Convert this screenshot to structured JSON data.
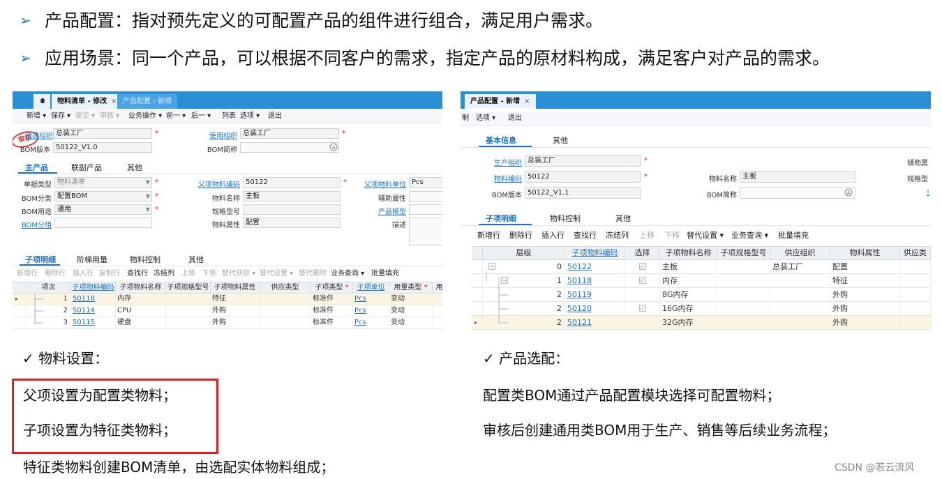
{
  "bullets": [
    {
      "text": "产品配置：指对预先定义的可配置产品的组件进行组合，满足用户需求。"
    },
    {
      "text": "应用场景：同一个产品，可以根据不同客户的需求，指定产品的原材料构成，满足客户对产品的需求。"
    }
  ],
  "icons": {
    "arrow": "➢",
    "check": "✓",
    "home": "home-icon",
    "close": "×"
  },
  "colors": {
    "accent": "#2b8fd6",
    "link": "#1f6fc4",
    "required": "#e02020",
    "highlight_box": "#e02020"
  },
  "left_panel": {
    "tabs": [
      {
        "label": "物料清单 - 修改",
        "close": "×"
      },
      {
        "label": "产品配置 - 新增"
      }
    ],
    "toolbar": [
      "新增 ▾",
      "保存 ▾",
      "提交 ▾",
      "审核 ▾",
      "业务操作 ▾",
      "前一 ▾",
      "后一 ▾",
      "列表",
      "选项 ▾",
      "退出"
    ],
    "stamp": "审核",
    "form_top": {
      "create_org_label": "创建组织",
      "create_org_value": "总装工厂",
      "bom_version_label": "BOM版本",
      "bom_version_value": "50122_V1.0",
      "use_org_label": "使用组织",
      "use_org_value": "总装工厂",
      "bom_short_label": "BOM简称",
      "bom_short_value": ""
    },
    "section_tabs": [
      "主产品",
      "联副产品",
      "其他"
    ],
    "form_main": {
      "doc_type_label": "单据类型",
      "doc_type_value": "物料清单",
      "bom_class_label": "BOM分类",
      "bom_class_value": "配置BOM",
      "bom_use_label": "BOM用途",
      "bom_use_value": "通用",
      "bom_group_label": "BOM分组",
      "bom_group_value": "",
      "parent_code_label": "父项物料编码",
      "parent_code_value": "50122",
      "material_name_label": "物料名称",
      "material_name_value": "主板",
      "spec_label": "规格型号",
      "spec_value": "",
      "material_attr_label": "物料属性",
      "material_attr_value": "配置",
      "parent_unit_label": "父项物料单位",
      "parent_unit_value": "Pcs",
      "aux_attr_label": "辅助属性",
      "product_model_label": "产品模型",
      "desc_label": "描述"
    },
    "detail_tabs": [
      "子项明细",
      "阶梯用量",
      "物料控制",
      "其他"
    ],
    "grid_toolbar": [
      "新增行",
      "删除行",
      "插入行",
      "复制行",
      "查找行",
      "冻结列",
      "上移",
      "下移",
      "替代获取 ▾",
      "替代设置 ▾",
      "替代删除",
      "业务查询 ▾",
      "批量填充"
    ],
    "columns": [
      "项次",
      "子项物料编码",
      "子项物料名称",
      "子项规格型号",
      "子项物料属性",
      "供应类型",
      "子项类型",
      "子项单位",
      "用量类型",
      "用"
    ],
    "rows": [
      {
        "seq": "1",
        "code": "50118",
        "name": "内存",
        "spec": "",
        "attr": "特征",
        "supply": "",
        "type": "标准件",
        "unit": "Pcs",
        "qty_type": "变动"
      },
      {
        "seq": "2",
        "code": "50114",
        "name": "CPU",
        "spec": "",
        "attr": "外购",
        "supply": "",
        "type": "标准件",
        "unit": "Pcs",
        "qty_type": "变动"
      },
      {
        "seq": "3",
        "code": "50115",
        "name": "硬盘",
        "spec": "",
        "attr": "外购",
        "supply": "",
        "type": "标准件",
        "unit": "Pcs",
        "qty_type": "变动"
      }
    ]
  },
  "right_panel": {
    "tabs": [
      {
        "label": "产品配置 - 新增",
        "close": "×"
      }
    ],
    "toolbar": [
      "制",
      "选项 ▾",
      "退出"
    ],
    "section_tabs": [
      "基本信息",
      "其他"
    ],
    "form": {
      "prod_org_label": "生产组织",
      "prod_org_value": "总装工厂",
      "material_code_label": "物料编码",
      "material_code_value": "50122",
      "bom_version_label": "BOM版本",
      "bom_version_value": "50122_V1.1",
      "material_name_label": "物料名称",
      "material_name_value": "主板",
      "bom_short_label": "BOM简称",
      "bom_short_value": "",
      "aux_label": "辅助属",
      "spec_label": "规格型"
    },
    "detail_tabs": [
      "子项明细",
      "物料控制",
      "其他"
    ],
    "grid_toolbar": [
      "新增行",
      "删除行",
      "插入行",
      "查找行",
      "冻结列",
      "上移",
      "下移",
      "替代设置 ▾",
      "业务查询 ▾",
      "批量填充"
    ],
    "columns": [
      "层级",
      "子项物料编码",
      "选择",
      "子项物料名称",
      "子项规格型号",
      "供应组织",
      "物料属性",
      "供应类"
    ],
    "rows": [
      {
        "level": "0",
        "code": "50122",
        "select": true,
        "name": "主板",
        "spec": "",
        "org": "总装工厂",
        "attr": "配置"
      },
      {
        "level": "1",
        "code": "50118",
        "select": true,
        "name": "内存",
        "spec": "",
        "org": "",
        "attr": "特征"
      },
      {
        "level": "2",
        "code": "50119",
        "select": false,
        "name": "8G内存",
        "spec": "",
        "org": "",
        "attr": "外购"
      },
      {
        "level": "2",
        "code": "50120",
        "select": true,
        "name": "16G内存",
        "spec": "",
        "org": "",
        "attr": "外购"
      },
      {
        "level": "2",
        "code": "50121",
        "select": false,
        "name": "32G内存",
        "spec": "",
        "org": "",
        "attr": "外购"
      }
    ]
  },
  "captions": {
    "material_setting_title": "物料设置：",
    "box_line1": "父项设置为配置类物料；",
    "box_line2": "子项设置为特征类物料；",
    "line3": "特征类物料创建BOM清单，由选配实体物料组成；",
    "product_select_title": "产品选配：",
    "right_line1": "配置类BOM通过产品配置模块选择可配置物料；",
    "right_line2": "审核后创建通用类BOM用于生产、销售等后续业务流程；",
    "watermark": "CSDN @若云流风"
  }
}
